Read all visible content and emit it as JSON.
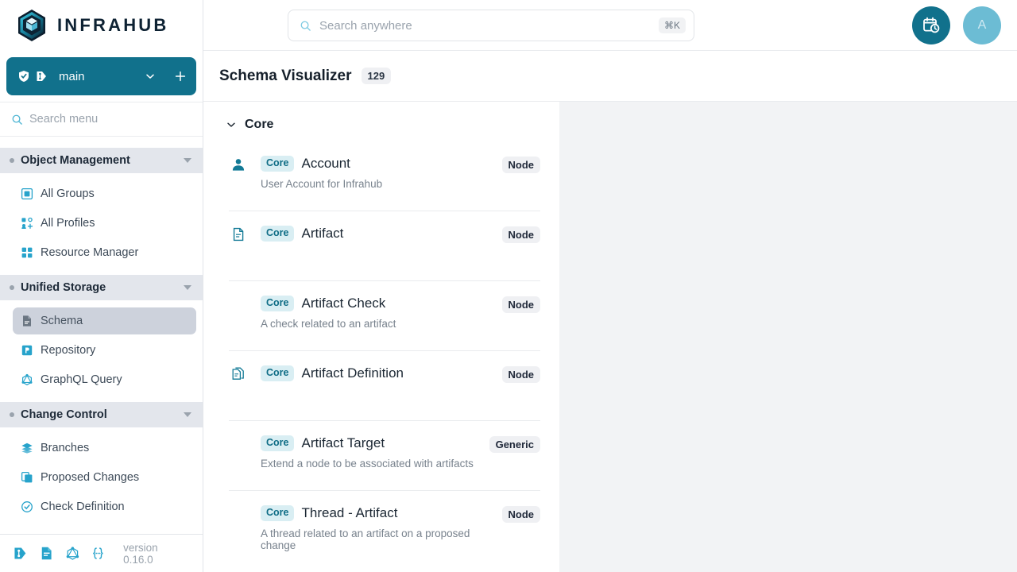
{
  "brand": {
    "name": "INFRAHUB",
    "logo_icon": "infrahub-hexagon-logo"
  },
  "branch": {
    "name": "main",
    "shield_icon": "shield-check-icon",
    "git_icon": "git-branch-icon",
    "chevron_icon": "chevron-down-icon",
    "add_icon": "plus-icon",
    "accent_color": "#11718c"
  },
  "menu_search": {
    "placeholder": "Search menu",
    "icon": "search-icon"
  },
  "sidebar": {
    "sections": [
      {
        "title": "Object Management",
        "caret_icon": "caret-down-icon",
        "items": [
          {
            "label": "All Groups",
            "icon": "group-icon",
            "active": false
          },
          {
            "label": "All Profiles",
            "icon": "profiles-icon",
            "active": false
          },
          {
            "label": "Resource Manager",
            "icon": "grid-icon",
            "active": false
          }
        ]
      },
      {
        "title": "Unified Storage",
        "caret_icon": "caret-down-icon",
        "items": [
          {
            "label": "Schema",
            "icon": "schema-file-icon",
            "active": true
          },
          {
            "label": "Repository",
            "icon": "repository-icon",
            "active": false
          },
          {
            "label": "GraphQL Query",
            "icon": "graphql-icon",
            "active": false
          }
        ]
      },
      {
        "title": "Change Control",
        "caret_icon": "caret-down-icon",
        "items": [
          {
            "label": "Branches",
            "icon": "layers-icon",
            "active": false
          },
          {
            "label": "Proposed Changes",
            "icon": "copy-pages-icon",
            "active": false
          },
          {
            "label": "Check Definition",
            "icon": "check-definition-icon",
            "active": false
          }
        ]
      }
    ]
  },
  "sidebar_footer": {
    "icons": [
      "git-icon",
      "docs-file-icon",
      "graphql-icon",
      "json-braces-icon"
    ],
    "version": "version 0.16.0"
  },
  "topbar": {
    "search": {
      "placeholder": "Search anywhere",
      "shortcut": "⌘K",
      "icon": "search-icon"
    },
    "time_travel_icon": "calendar-clock-icon",
    "avatar_initial": "A"
  },
  "page": {
    "title": "Schema Visualizer",
    "count": "129"
  },
  "schema": {
    "group": {
      "name": "Core",
      "caret_icon": "chevron-down-icon"
    },
    "rows": [
      {
        "icon": "user-icon",
        "namespace": "Core",
        "label": "Account",
        "description": "User Account for Infrahub",
        "kind": "Node"
      },
      {
        "icon": "file-text-icon",
        "namespace": "Core",
        "label": "Artifact",
        "description": "",
        "kind": "Node"
      },
      {
        "icon": "",
        "namespace": "Core",
        "label": "Artifact Check",
        "description": "A check related to an artifact",
        "kind": "Node"
      },
      {
        "icon": "copy-files-icon",
        "namespace": "Core",
        "label": "Artifact Definition",
        "description": "",
        "kind": "Node"
      },
      {
        "icon": "",
        "namespace": "Core",
        "label": "Artifact Target",
        "description": "Extend a node to be associated with artifacts",
        "kind": "Generic"
      },
      {
        "icon": "",
        "namespace": "Core",
        "label": "Thread - Artifact",
        "description": "A thread related to an artifact on a proposed change",
        "kind": "Node"
      }
    ]
  }
}
